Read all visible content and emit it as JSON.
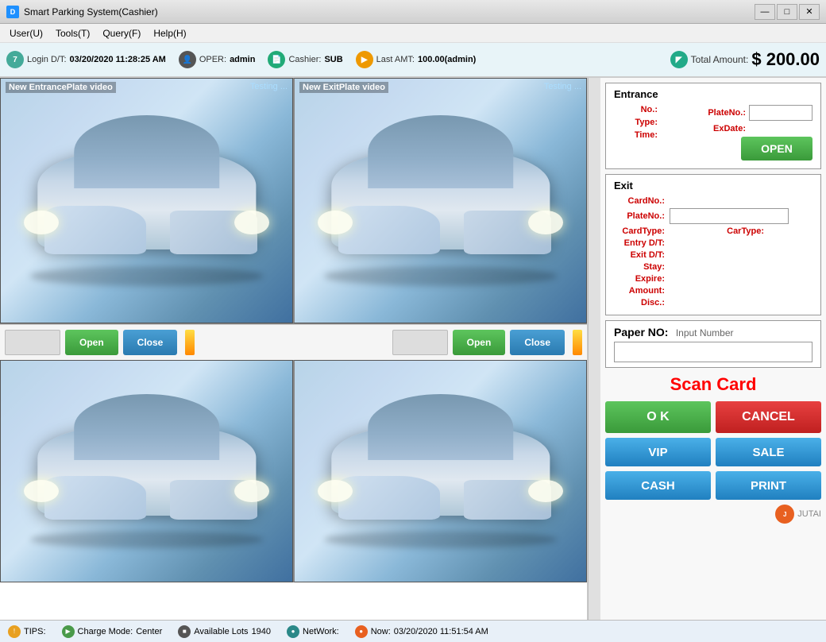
{
  "titleBar": {
    "title": "Smart Parking System(Cashier)",
    "icon": "D"
  },
  "menuBar": {
    "items": [
      "User(U)",
      "Tools(T)",
      "Query(F)",
      "Help(H)"
    ]
  },
  "statusBar": {
    "loginLabel": "Login D/T:",
    "loginValue": "03/20/2020 11:28:25 AM",
    "operLabel": "OPER:",
    "operValue": "admin",
    "cashierLabel": "Cashier:",
    "cashierValue": "SUB",
    "lastAmtLabel": "Last AMT:",
    "lastAmtValue": "100.00(admin)",
    "totalLabel": "Total Amount:",
    "totalValue": "$ 200.00"
  },
  "videoPanel": {
    "entrance": {
      "label": "New EntrancePlate video",
      "status": "Testing ..."
    },
    "exit": {
      "label": "New ExitPlate video",
      "status": "Testing ..."
    },
    "buttons": {
      "open": "Open",
      "close": "Close"
    }
  },
  "rightPanel": {
    "entranceSection": {
      "title": "Entrance",
      "noLabel": "No.:",
      "plateNoLabel": "PlateNo.:",
      "typeLabel": "Type:",
      "exDateLabel": "ExDate:",
      "timeLabel": "Time:",
      "openBtn": "OPEN"
    },
    "exitSection": {
      "title": "Exit",
      "cardNoLabel": "CardNo.:",
      "plateNoLabel": "PlateNo.:",
      "cardTypeLabel": "CardType:",
      "carTypeLabel": "CarType:",
      "entryDTLabel": "Entry D/T:",
      "exitDTLabel": "Exit D/T:",
      "stayLabel": "Stay:",
      "expireLabel": "Expire:",
      "amountLabel": "Amount:",
      "discLabel": "Disc.:"
    },
    "paperSection": {
      "label": "Paper NO:",
      "hint": "Input Number"
    },
    "scanCard": "Scan Card",
    "buttons": {
      "ok": "O K",
      "cancel": "CANCEL",
      "vip": "VIP",
      "sale": "SALE",
      "cash": "CASH",
      "print": "PRINT"
    }
  },
  "bottomBar": {
    "tipsLabel": "TIPS:",
    "chargeModeLabel": "Charge Mode:",
    "chargeModeValue": "Center",
    "availableLotsLabel": "Available Lots",
    "availableLotsValue": "1940",
    "networkLabel": "NetWork:",
    "nowLabel": "Now:",
    "nowValue": "03/20/2020 11:51:54 AM",
    "logoText": "JUTAI"
  }
}
